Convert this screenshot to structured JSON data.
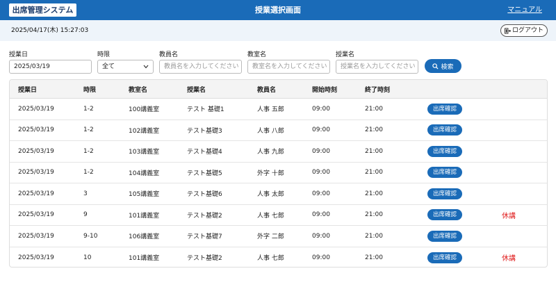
{
  "header": {
    "logo": "出席管理システム",
    "title": "授業選択画面",
    "manual": "マニュアル"
  },
  "subbar": {
    "datetime": "2025/04/17(木) 15:27:03",
    "logout": "ログアウト"
  },
  "search": {
    "date_label": "授業日",
    "date_value": "2025/03/19",
    "period_label": "時限",
    "period_value": "全て",
    "teacher_label": "教員名",
    "teacher_placeholder": "教員名を入力してください",
    "room_label": "教室名",
    "room_placeholder": "教室名を入力してください",
    "class_label": "授業名",
    "class_placeholder": "授業名を入力してください",
    "button": "検索"
  },
  "table": {
    "headers": [
      "授業日",
      "時限",
      "教室名",
      "授業名",
      "教員名",
      "開始時刻",
      "終了時刻"
    ],
    "rows": [
      {
        "date": "2025/03/19",
        "period": "1-2",
        "room": "100講義室",
        "class": "テスト 基礎1",
        "teacher": "人事 五郎",
        "start": "09:00",
        "end": "21:00",
        "btn": "出席確認",
        "status": ""
      },
      {
        "date": "2025/03/19",
        "period": "1-2",
        "room": "102講義室",
        "class": "テスト基礎3",
        "teacher": "人事 八郎",
        "start": "09:00",
        "end": "21:00",
        "btn": "出席確認",
        "status": ""
      },
      {
        "date": "2025/03/19",
        "period": "1-2",
        "room": "103講義室",
        "class": "テスト基礎4",
        "teacher": "人事 九郎",
        "start": "09:00",
        "end": "21:00",
        "btn": "出席確認",
        "status": ""
      },
      {
        "date": "2025/03/19",
        "period": "1-2",
        "room": "104講義室",
        "class": "テスト基礎5",
        "teacher": "外字 十郎",
        "start": "09:00",
        "end": "21:00",
        "btn": "出席確認",
        "status": ""
      },
      {
        "date": "2025/03/19",
        "period": "3",
        "room": "105講義室",
        "class": "テスト基礎6",
        "teacher": "人事 太郎",
        "start": "09:00",
        "end": "21:00",
        "btn": "出席確認",
        "status": ""
      },
      {
        "date": "2025/03/19",
        "period": "9",
        "room": "101講義室",
        "class": "テスト基礎2",
        "teacher": "人事 七郎",
        "start": "09:00",
        "end": "21:00",
        "btn": "出席確認",
        "status": "休講"
      },
      {
        "date": "2025/03/19",
        "period": "9-10",
        "room": "106講義室",
        "class": "テスト基礎7",
        "teacher": "外字 二郎",
        "start": "09:00",
        "end": "21:00",
        "btn": "出席確認",
        "status": ""
      },
      {
        "date": "2025/03/19",
        "period": "10",
        "room": "101講義室",
        "class": "テスト基礎2",
        "teacher": "人事 七郎",
        "start": "09:00",
        "end": "21:00",
        "btn": "出席確認",
        "status": "休講"
      }
    ]
  },
  "colors": {
    "primary": "#1a6bb8",
    "cancel": "#e02020",
    "subbar": "#eef4fa"
  }
}
